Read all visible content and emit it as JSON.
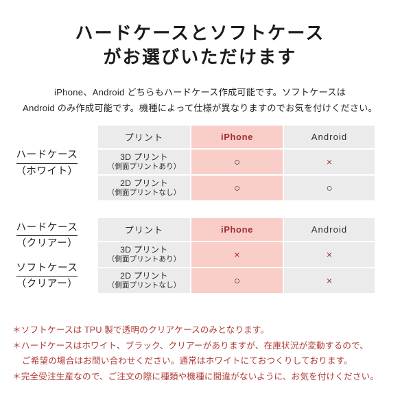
{
  "title": {
    "line1": "ハードケースとソフトケース",
    "line2": "がお選びいただけます"
  },
  "subtitle": {
    "line1": "iPhone、Android どちらもハードケース作成可能です。ソフトケースは",
    "line2": "Android のみ作成可能です。機種によって仕様が異なりますのでお気を付けください。"
  },
  "colors": {
    "accent_pink": "#f9cdc8",
    "cell_gray": "#ebebeb",
    "cross_red": "#a83232",
    "note_red": "#b03a36",
    "iphone_label": "#9e2f2f"
  },
  "tables": [
    {
      "id": "white",
      "labels": [
        {
          "main": "ハードケース",
          "sub": "（ホワイト）"
        }
      ],
      "headers": [
        {
          "text": "プリント",
          "highlight": false
        },
        {
          "text": "iPhone",
          "highlight": true
        },
        {
          "text": "Android",
          "highlight": false
        }
      ],
      "rows": [
        {
          "label_main": "3D プリント",
          "label_sub": "（側面プリントあり）",
          "iphone": "○",
          "android": "×"
        },
        {
          "label_main": "2D プリント",
          "label_sub": "（側面プリントなし）",
          "iphone": "○",
          "android": "○"
        }
      ]
    },
    {
      "id": "clear",
      "labels": [
        {
          "main": "ハードケース",
          "sub": "（クリアー）"
        },
        {
          "main": "ソフトケース",
          "sub": "（クリアー）"
        }
      ],
      "headers": [
        {
          "text": "プリント",
          "highlight": false
        },
        {
          "text": "iPhone",
          "highlight": true
        },
        {
          "text": "Android",
          "highlight": false
        }
      ],
      "rows": [
        {
          "label_main": "3D プリント",
          "label_sub": "（側面プリントあり）",
          "iphone": "×",
          "android": "×"
        },
        {
          "label_main": "2D プリント",
          "label_sub": "（側面プリントなし）",
          "iphone": "○",
          "android": "×"
        }
      ]
    }
  ],
  "notes": [
    {
      "text": "＊ソフトケースは TPU 製で透明のクリアケースのみとなります。",
      "indent": false
    },
    {
      "text": "＊ハードケースはホワイト、ブラック、クリアーがありますが、在庫状況が変動するので、",
      "indent": false
    },
    {
      "text": "ご希望の場合はお問い合わせください。通常はホワイトにておつくりしております。",
      "indent": true
    },
    {
      "text": "＊完全受注生産なので、ご注文の際に種類や機種に間違がないように、お気を付けください。",
      "indent": false
    }
  ]
}
